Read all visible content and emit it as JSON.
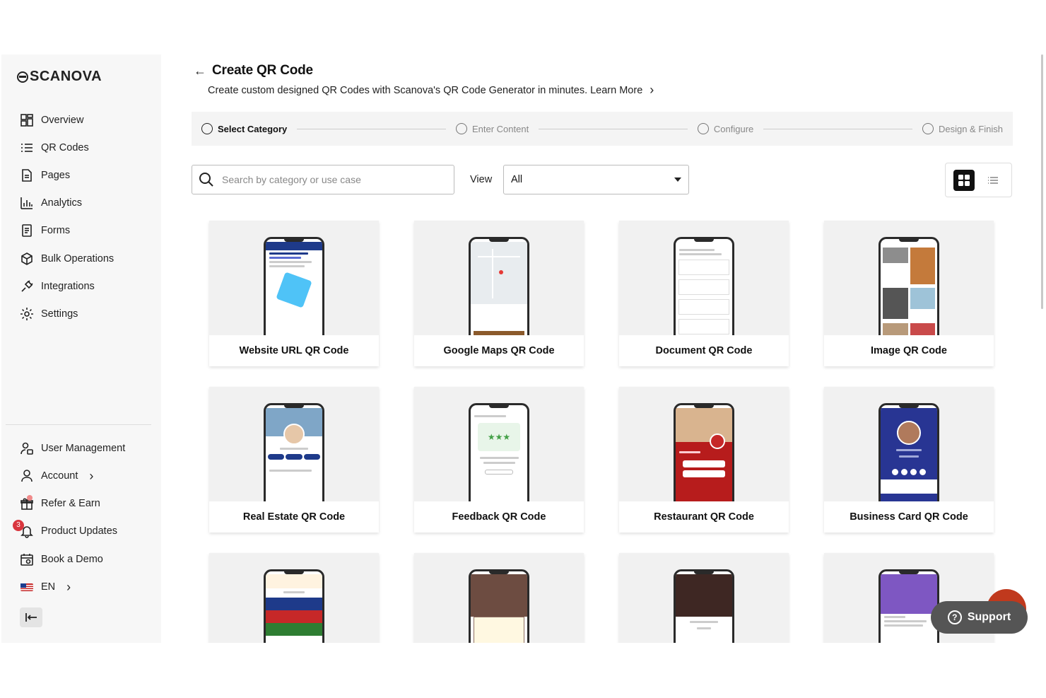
{
  "brand": {
    "name": "SCANOVA"
  },
  "sidebar": {
    "items": [
      {
        "label": "Overview",
        "icon": "overview-icon"
      },
      {
        "label": "QR Codes",
        "icon": "list-icon"
      },
      {
        "label": "Pages",
        "icon": "page-icon"
      },
      {
        "label": "Analytics",
        "icon": "analytics-icon"
      },
      {
        "label": "Forms",
        "icon": "form-icon"
      },
      {
        "label": "Bulk Operations",
        "icon": "cube-icon"
      },
      {
        "label": "Integrations",
        "icon": "plug-icon"
      },
      {
        "label": "Settings",
        "icon": "gear-icon"
      }
    ],
    "bottom": [
      {
        "label": "User Management",
        "icon": "user-management-icon"
      },
      {
        "label": "Account",
        "icon": "user-icon",
        "chevron": "›"
      },
      {
        "label": "Refer & Earn",
        "icon": "gift-icon"
      },
      {
        "label": "Product Updates",
        "icon": "bell-icon",
        "badge": "3"
      },
      {
        "label": "Book a Demo",
        "icon": "calendar-icon"
      },
      {
        "label": "EN",
        "icon": "us-flag-icon",
        "chevron": "›"
      }
    ]
  },
  "header": {
    "back": "←",
    "title": "Create QR Code",
    "subtitle": "Create custom designed QR Codes with Scanova's QR Code Generator in minutes.",
    "learn_more": "Learn More",
    "learn_chevron": "›"
  },
  "stepper": {
    "steps": [
      "Select Category",
      "Enter Content",
      "Configure",
      "Design & Finish"
    ]
  },
  "search": {
    "placeholder": "Search by category or use case"
  },
  "view": {
    "label": "View",
    "selected": "All"
  },
  "cards": [
    {
      "label": "Website URL QR Code"
    },
    {
      "label": "Google Maps QR Code"
    },
    {
      "label": "Document QR Code"
    },
    {
      "label": "Image QR Code"
    },
    {
      "label": "Real Estate QR Code"
    },
    {
      "label": "Feedback QR Code"
    },
    {
      "label": "Restaurant QR Code"
    },
    {
      "label": "Business Card QR Code"
    },
    {
      "label": ""
    },
    {
      "label": ""
    },
    {
      "label": ""
    },
    {
      "label": ""
    }
  ],
  "support": {
    "label": "Support"
  },
  "colors": {
    "sidebar_bg": "#f7f7f7",
    "accent_dark": "#111111",
    "badge_red": "#d9363e",
    "support_bg": "#555555"
  }
}
